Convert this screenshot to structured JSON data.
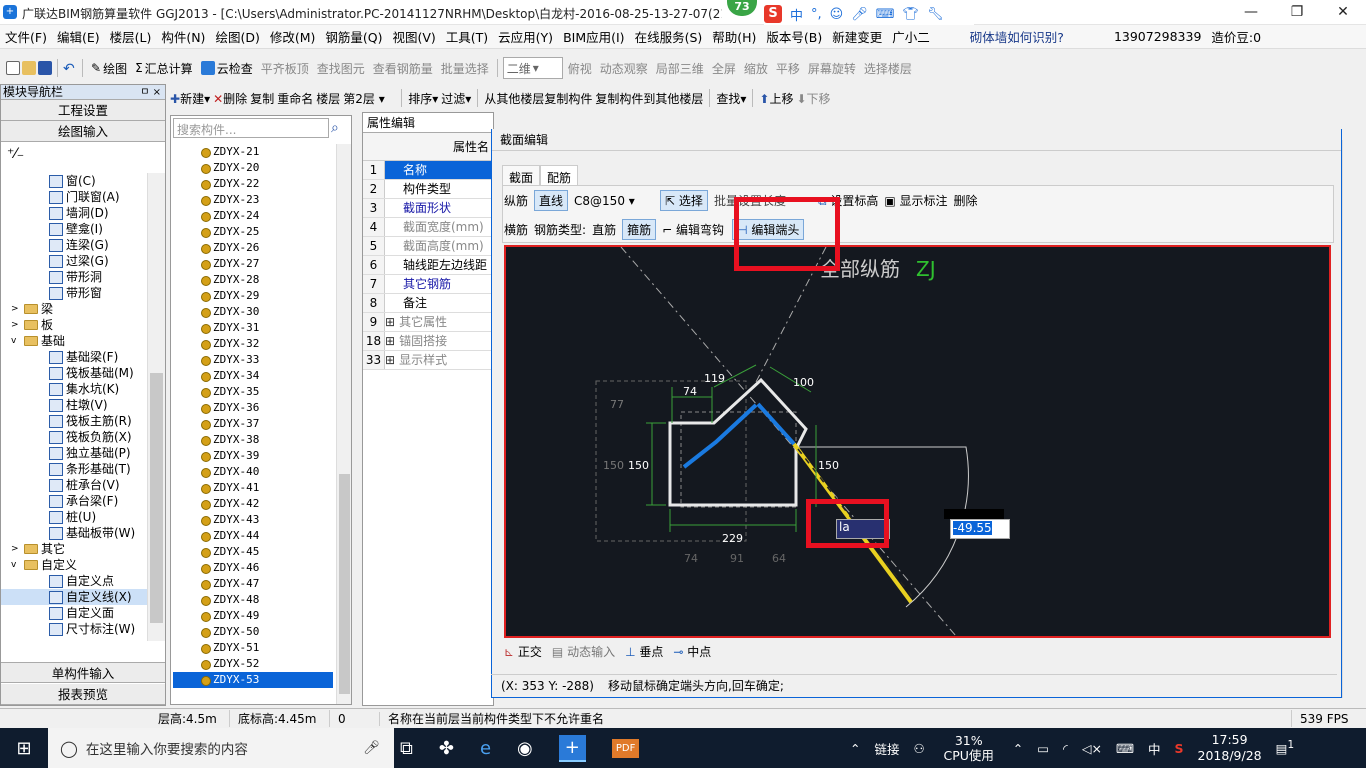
{
  "title": {
    "text": "广联达BIM钢筋算量软件 GGJ2013 - [C:\\Users\\Administrator.PC-20141127NRHM\\Desktop\\白龙村-2016-08-25-13-27-07(21"
  },
  "badge": "73",
  "ime": {
    "logo": "S",
    "lang": "中",
    "dot": "°,"
  },
  "menu": [
    "文件(F)",
    "编辑(E)",
    "楼层(L)",
    "构件(N)",
    "绘图(D)",
    "修改(M)",
    "钢筋量(Q)",
    "视图(V)",
    "工具(T)",
    "云应用(Y)",
    "BIM应用(I)",
    "在线服务(S)",
    "帮助(H)",
    "版本号(B)",
    "新建变更",
    "广小二",
    "砌体墙如何识别?",
    "13907298339",
    "造价豆:0"
  ],
  "toolbar": {
    "draw": "绘图",
    "sum": "汇总计算",
    "cloud": "云检查",
    "flat": "平齐板顶",
    "find": "查找图元",
    "view_steel": "查看钢筋量",
    "batch": "批量选择",
    "view2d": "二维",
    "top": "俯视",
    "dynamic": "动态观察",
    "local3d": "局部三维",
    "full": "全屏",
    "zoom": "缩放",
    "pan": "平移",
    "rotate": "屏幕旋转",
    "floorsel": "选择楼层"
  },
  "toolbar2": {
    "new": "新建",
    "delete": "删除",
    "copy": "复制",
    "rename": "重命名",
    "floor_label": "楼层",
    "floor": "第2层",
    "sort": "排序",
    "filter": "过滤",
    "copy_from": "从其他楼层复制构件",
    "copy_to": "复制构件到其他楼层",
    "find": "查找",
    "up": "上移",
    "down": "下移"
  },
  "nav": {
    "title": "模块导航栏",
    "pin": "ㅁ ×",
    "btn1": "工程设置",
    "btn2": "绘图输入",
    "btn3": "单构件输入",
    "btn4": "报表预览"
  },
  "tree": [
    {
      "label": "窗(C)",
      "indent": 48,
      "type": "item"
    },
    {
      "label": "门联窗(A)",
      "indent": 48,
      "type": "item"
    },
    {
      "label": "墙洞(D)",
      "indent": 48,
      "type": "item"
    },
    {
      "label": "壁龛(I)",
      "indent": 48,
      "type": "item"
    },
    {
      "label": "连梁(G)",
      "indent": 48,
      "type": "item"
    },
    {
      "label": "过梁(G)",
      "indent": 48,
      "type": "item"
    },
    {
      "label": "带形洞",
      "indent": 48,
      "type": "item"
    },
    {
      "label": "带形窗",
      "indent": 48,
      "type": "item"
    },
    {
      "label": "梁",
      "indent": 10,
      "type": "folder",
      "toggle": ">"
    },
    {
      "label": "板",
      "indent": 10,
      "type": "folder",
      "toggle": ">"
    },
    {
      "label": "基础",
      "indent": 10,
      "type": "folder",
      "toggle": "v"
    },
    {
      "label": "基础梁(F)",
      "indent": 48,
      "type": "item"
    },
    {
      "label": "筏板基础(M)",
      "indent": 48,
      "type": "item"
    },
    {
      "label": "集水坑(K)",
      "indent": 48,
      "type": "item"
    },
    {
      "label": "柱墩(V)",
      "indent": 48,
      "type": "item"
    },
    {
      "label": "筏板主筋(R)",
      "indent": 48,
      "type": "item"
    },
    {
      "label": "筏板负筋(X)",
      "indent": 48,
      "type": "item"
    },
    {
      "label": "独立基础(P)",
      "indent": 48,
      "type": "item"
    },
    {
      "label": "条形基础(T)",
      "indent": 48,
      "type": "item"
    },
    {
      "label": "桩承台(V)",
      "indent": 48,
      "type": "item"
    },
    {
      "label": "承台梁(F)",
      "indent": 48,
      "type": "item"
    },
    {
      "label": "桩(U)",
      "indent": 48,
      "type": "item"
    },
    {
      "label": "基础板带(W)",
      "indent": 48,
      "type": "item"
    },
    {
      "label": "其它",
      "indent": 10,
      "type": "folder",
      "toggle": ">"
    },
    {
      "label": "自定义",
      "indent": 10,
      "type": "folder",
      "toggle": "v"
    },
    {
      "label": "自定义点",
      "indent": 48,
      "type": "item"
    },
    {
      "label": "自定义线(X)",
      "indent": 48,
      "type": "item",
      "selected": true
    },
    {
      "label": "自定义面",
      "indent": 48,
      "type": "item"
    },
    {
      "label": "尺寸标注(W)",
      "indent": 48,
      "type": "item"
    }
  ],
  "search_placeholder": "搜索构件...",
  "components": [
    "ZDYX-21",
    "ZDYX-20",
    "ZDYX-22",
    "ZDYX-23",
    "ZDYX-24",
    "ZDYX-25",
    "ZDYX-26",
    "ZDYX-27",
    "ZDYX-28",
    "ZDYX-29",
    "ZDYX-30",
    "ZDYX-31",
    "ZDYX-32",
    "ZDYX-33",
    "ZDYX-34",
    "ZDYX-35",
    "ZDYX-36",
    "ZDYX-37",
    "ZDYX-38",
    "ZDYX-39",
    "ZDYX-40",
    "ZDYX-41",
    "ZDYX-42",
    "ZDYX-43",
    "ZDYX-44",
    "ZDYX-45",
    "ZDYX-46",
    "ZDYX-47",
    "ZDYX-48",
    "ZDYX-49",
    "ZDYX-50",
    "ZDYX-51",
    "ZDYX-52",
    "ZDYX-53"
  ],
  "props_tab": "属性编辑",
  "props_header": "属性名",
  "props": [
    {
      "num": "1",
      "name": "名称",
      "color": "#fff",
      "bg": "#0a64d8"
    },
    {
      "num": "2",
      "name": "构件类型",
      "color": "#000"
    },
    {
      "num": "3",
      "name": "截面形状",
      "color": "#1a1aa8"
    },
    {
      "num": "4",
      "name": "截面宽度(mm)",
      "color": "#888"
    },
    {
      "num": "5",
      "name": "截面高度(mm)",
      "color": "#888"
    },
    {
      "num": "6",
      "name": "轴线距左边线距",
      "color": "#000"
    },
    {
      "num": "7",
      "name": "其它钢筋",
      "color": "#1a1aa8"
    },
    {
      "num": "8",
      "name": "备注",
      "color": "#000"
    },
    {
      "num": "9",
      "name": "其它属性",
      "color": "#888",
      "plus": true
    },
    {
      "num": "18",
      "name": "锚固搭接",
      "color": "#888",
      "plus": true
    },
    {
      "num": "33",
      "name": "显示样式",
      "color": "#888",
      "plus": true
    }
  ],
  "dialog": {
    "title": "截面编辑",
    "tab1": "截面",
    "tab2": "配筋",
    "row1": {
      "long": "纵筋",
      "line": "直线",
      "spec": "C8@150",
      "select": "选择",
      "set_label": "设置标高",
      "show_label": "显示标注",
      "delete": "删除",
      "hidden": "批量设置长度"
    },
    "row2": {
      "stirrup": "横筋",
      "type_label": "钢筋类型:",
      "straight": "直筋",
      "stirrup2": "箍筋",
      "edit_bend": "编辑弯钩",
      "edit_end": "编辑端头"
    },
    "canvas_title_a": "全部纵筋",
    "canvas_title_b": "ZJ",
    "dims": {
      "d74": "74",
      "d119": "119",
      "d100": "100",
      "d77": "77",
      "d150a": "150",
      "d150b": "150",
      "d150c": "150",
      "d229": "229",
      "d74b": "74",
      "d91": "91",
      "d64": "64"
    },
    "input_la": "la",
    "input_angle": "-49.55",
    "bottom": {
      "ortho": "正交",
      "dyn": "动态输入",
      "perp": "垂点",
      "mid": "中点"
    },
    "status": {
      "coords": "(X: 353 Y: -288)",
      "msg": "移动鼠标确定端头方向,回车确定;"
    }
  },
  "statusbar": {
    "floor_h": "层高:4.5m",
    "base_h": "底标高:4.45m",
    "zero": "0",
    "msg": "名称在当前层当前构件类型下不允许重名",
    "fps": "539 FPS"
  },
  "taskbar": {
    "search": "在这里输入你要搜索的内容",
    "link": "链接",
    "cpu": "31%",
    "cpu_label": "CPU使用",
    "lang": "中",
    "time": "17:59",
    "date": "2018/9/28",
    "notif": "1"
  }
}
